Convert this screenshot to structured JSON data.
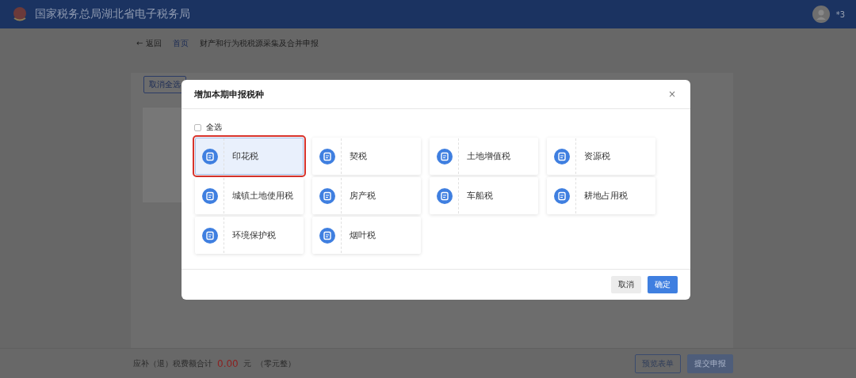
{
  "header": {
    "title": "国家税务总局湖北省电子税务局",
    "user": "*3"
  },
  "breadcrumb": {
    "back": "← 返回",
    "items": [
      "首页",
      "财产和行为税税源采集及合并申报"
    ]
  },
  "toolbar": {
    "buttons": [
      "取消全选"
    ]
  },
  "modal": {
    "title": "增加本期申报税种",
    "close": "×",
    "select_all": {
      "label": "全选",
      "checked": false
    },
    "tax_types": [
      {
        "label": "印花税",
        "selected": true
      },
      {
        "label": "契税",
        "selected": false
      },
      {
        "label": "土地增值税",
        "selected": false
      },
      {
        "label": "资源税",
        "selected": false
      },
      {
        "label": "城镇土地使用税",
        "selected": false
      },
      {
        "label": "房产税",
        "selected": false
      },
      {
        "label": "车船税",
        "selected": false
      },
      {
        "label": "耕地占用税",
        "selected": false
      },
      {
        "label": "环境保护税",
        "selected": false
      },
      {
        "label": "烟叶税",
        "selected": false
      }
    ],
    "buttons": [
      {
        "label": "取消",
        "kind": "secondary"
      },
      {
        "label": "确定",
        "kind": "primary"
      }
    ]
  },
  "footer": {
    "total_label": "应补（退）税费额合计",
    "amount": "0.00",
    "unit": "元",
    "amount_words": "（零元整）",
    "buttons": [
      {
        "label": "预览表单",
        "kind": "outline"
      },
      {
        "label": "提交申报",
        "kind": "disabled"
      }
    ]
  }
}
